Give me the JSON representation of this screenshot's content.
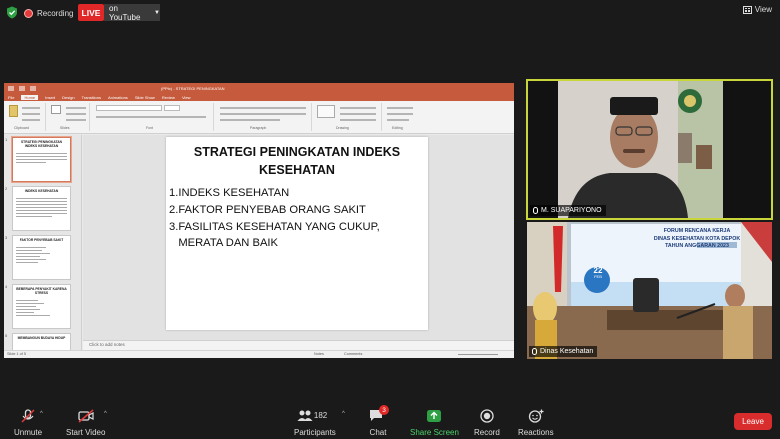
{
  "topbar": {
    "recording_label": "Recording",
    "live_badge": "LIVE",
    "youtube_button": "on YouTube",
    "view_button": "View"
  },
  "shared_screen": {
    "doc_title": "(PPtx) - STRATEGI PENINGKATAN",
    "ribbon_tabs": [
      "File",
      "Home",
      "Insert",
      "Design",
      "Transitions",
      "Animations",
      "Slide Show",
      "Review",
      "View"
    ],
    "ribbon_groups": [
      "Clipboard",
      "Slides",
      "Font",
      "Paragraph",
      "Drawing",
      "Editing"
    ],
    "thumbnails": [
      {
        "num": "1",
        "title": "STRATEGI PENINGKATAN INDEKS KESEHATAN"
      },
      {
        "num": "2",
        "title": "INDEKS KESEHATAN"
      },
      {
        "num": "3",
        "title": "FAKTOR PENYEBAB SAKIT"
      },
      {
        "num": "4",
        "title": "BEBERAPA PENYAKIT KARENA STRESS"
      },
      {
        "num": "5",
        "title": "MEMBANGUN BUDAYA HIDUP"
      }
    ],
    "slide": {
      "title": "STRATEGI PENINGKATAN INDEKS KESEHATAN",
      "items": [
        "1.INDEKS KESEHATAN",
        "2.FAKTOR PENYEBAB ORANG SAKIT",
        "3.FASILITAS KESEHATAN YANG CUKUP,",
        "   MERATA DAN BAIK"
      ]
    },
    "notes_placeholder": "Click to add notes",
    "status_left": "Slide 1 of 5",
    "status_notes": "Notes",
    "status_comments": "Comments"
  },
  "video": {
    "speaker_name": "M. SUAPARIYONO",
    "room_name": "Dinas Kesehatan",
    "banner_lines": [
      "FORUM RENCANA KERJA",
      "DINAS KESEHATAN KOTA DEPOK",
      "TAHUN ANGGARAN 2023"
    ],
    "banner_date": "22",
    "banner_month": "FEB"
  },
  "toolbar": {
    "unmute": "Unmute",
    "start_video": "Start Video",
    "participants": "Participants",
    "participants_count": "182",
    "chat": "Chat",
    "chat_badge": "3",
    "share_screen": "Share Screen",
    "record": "Record",
    "reactions": "Reactions",
    "leave": "Leave"
  },
  "colors": {
    "ppt_accent": "#c55a3c",
    "live_red": "#e02828",
    "active_speaker": "#c9d63a",
    "share_green": "#4fd26a"
  }
}
